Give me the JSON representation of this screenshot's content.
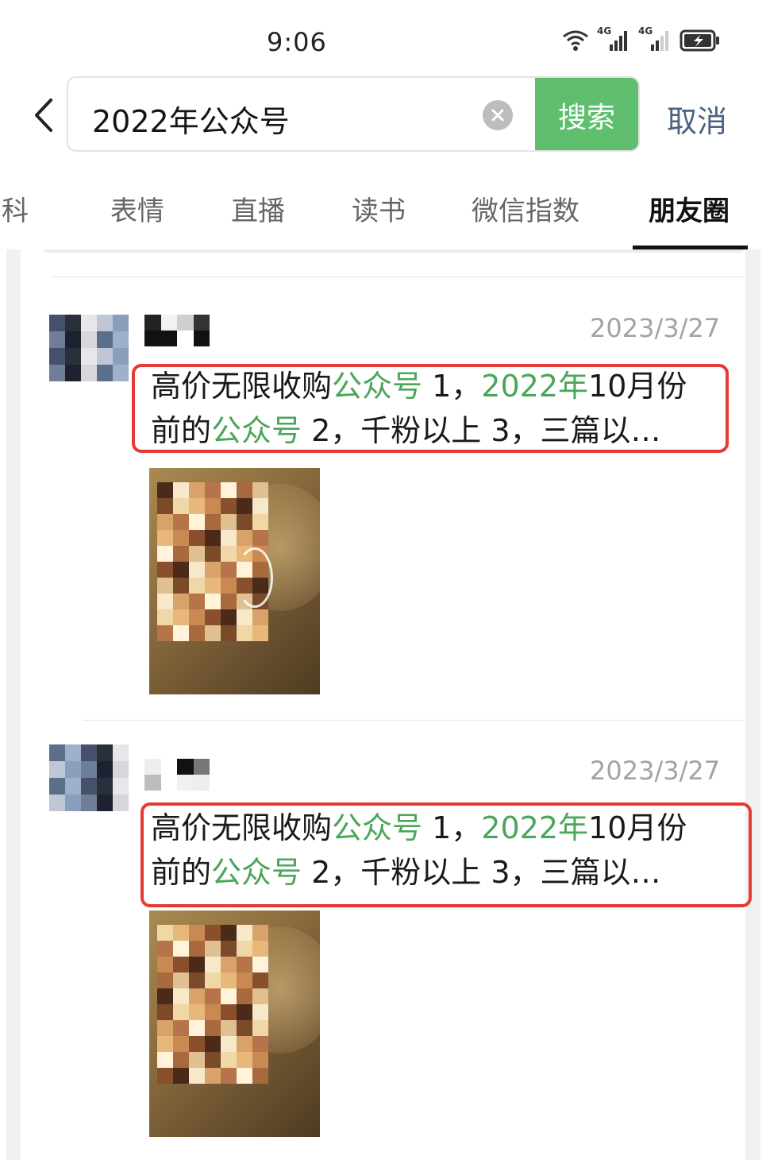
{
  "status_bar": {
    "time": "9:06",
    "signal1": "4G",
    "signal2": "4G",
    "icons": [
      "wifi-icon",
      "signal-icon",
      "signal-icon",
      "battery-charging-icon"
    ]
  },
  "search": {
    "query": "2022年公众号",
    "submit_label": "搜索",
    "cancel_label": "取消"
  },
  "tabs": [
    {
      "label": "百科",
      "active": false
    },
    {
      "label": "表情",
      "active": false
    },
    {
      "label": "直播",
      "active": false
    },
    {
      "label": "读书",
      "active": false
    },
    {
      "label": "微信指数",
      "active": false
    },
    {
      "label": "朋友圈",
      "active": true
    }
  ],
  "posts": [
    {
      "date": "2023/3/27",
      "segments": [
        {
          "text": "高价无限收购",
          "hl": false
        },
        {
          "text": "公众号",
          "hl": true
        },
        {
          "text": " 1，",
          "hl": false
        },
        {
          "text": "2022年",
          "hl": true
        },
        {
          "text": "10月份",
          "hl": false
        },
        {
          "text": "\n",
          "hl": false
        },
        {
          "text": "前的",
          "hl": false
        },
        {
          "text": "公众号",
          "hl": true
        },
        {
          "text": " 2，千粉以上 3，三篇以…",
          "hl": false
        }
      ]
    },
    {
      "date": "2023/3/27",
      "segments": [
        {
          "text": "高价无限收购",
          "hl": false
        },
        {
          "text": "公众号",
          "hl": true
        },
        {
          "text": " 1，",
          "hl": false
        },
        {
          "text": "2022年",
          "hl": true
        },
        {
          "text": "10月份",
          "hl": false
        },
        {
          "text": "\n",
          "hl": false
        },
        {
          "text": "前的",
          "hl": false
        },
        {
          "text": "公众号",
          "hl": true
        },
        {
          "text": " 2，千粉以上 3，三篇以…",
          "hl": false
        }
      ]
    }
  ],
  "colors": {
    "accent_green": "#5fbf6f",
    "highlight_green": "#4aa65a",
    "cancel_blue": "#4a6283",
    "annotation_red": "#e53935"
  }
}
